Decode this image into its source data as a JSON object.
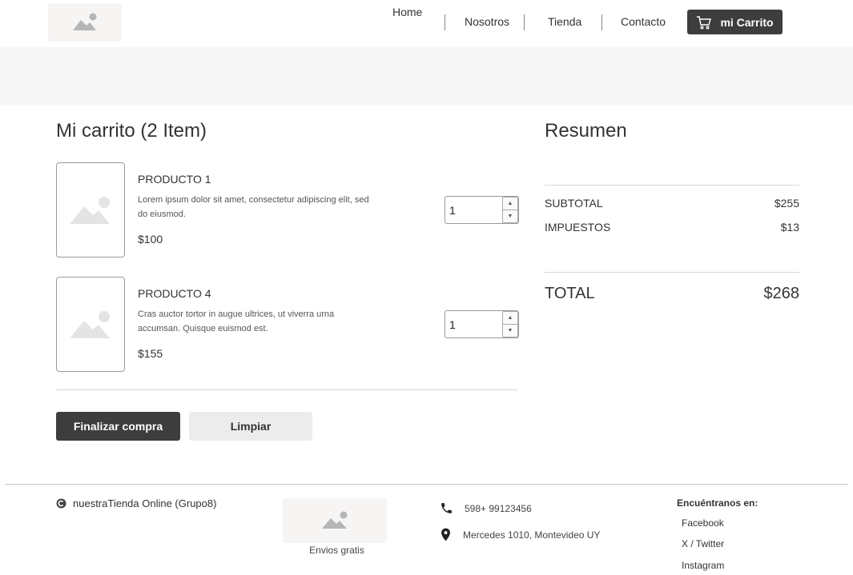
{
  "header": {
    "logo_icon": "image-placeholder-icon",
    "nav": [
      {
        "label": "Home"
      },
      {
        "label": "Nosotros"
      },
      {
        "label": "Tienda"
      },
      {
        "label": "Contacto"
      }
    ],
    "cart_button": {
      "label": "mi Carrito",
      "icon": "shopping-cart-icon"
    }
  },
  "cart": {
    "title": "Mi carrito (2 Item)",
    "items": [
      {
        "name": "PRODUCTO 1",
        "description": "Lorem ipsum dolor sit amet, consectetur adipiscing elit, sed do eiusmod.",
        "price": "$100",
        "quantity": "1"
      },
      {
        "name": "PRODUCTO 4",
        "description": "Cras auctor tortor in augue ultrices, ut viverra urna accumsan. Quisque euismod est.",
        "price": "$155",
        "quantity": "1"
      }
    ],
    "actions": {
      "checkout_label": "Finalizar compra",
      "clear_label": "Limpiar"
    }
  },
  "summary": {
    "title": "Resumen",
    "subtotal_label": "SUBTOTAL",
    "subtotal_value": "$255",
    "taxes_label": "IMPUESTOS",
    "taxes_value": "$13",
    "total_label": "TOTAL",
    "total_value": "$268"
  },
  "footer": {
    "brand": "nuestraTienda Online (Grupo8)",
    "brand_icon": "copyright-icon",
    "shipping_caption": "Envios gratis",
    "phone": "598+ 99123456",
    "address": "Mercedes 1010, Montevideo UY",
    "social_title": "Encuéntranos en:",
    "social": [
      {
        "label": "Facebook"
      },
      {
        "label": "X / Twitter"
      },
      {
        "label": "Instagram"
      }
    ]
  },
  "colors": {
    "dark_button": "#3d3d3d",
    "light_button": "#ececec",
    "banner": "#f6f6f6",
    "placeholder": "#f7f4f4"
  }
}
